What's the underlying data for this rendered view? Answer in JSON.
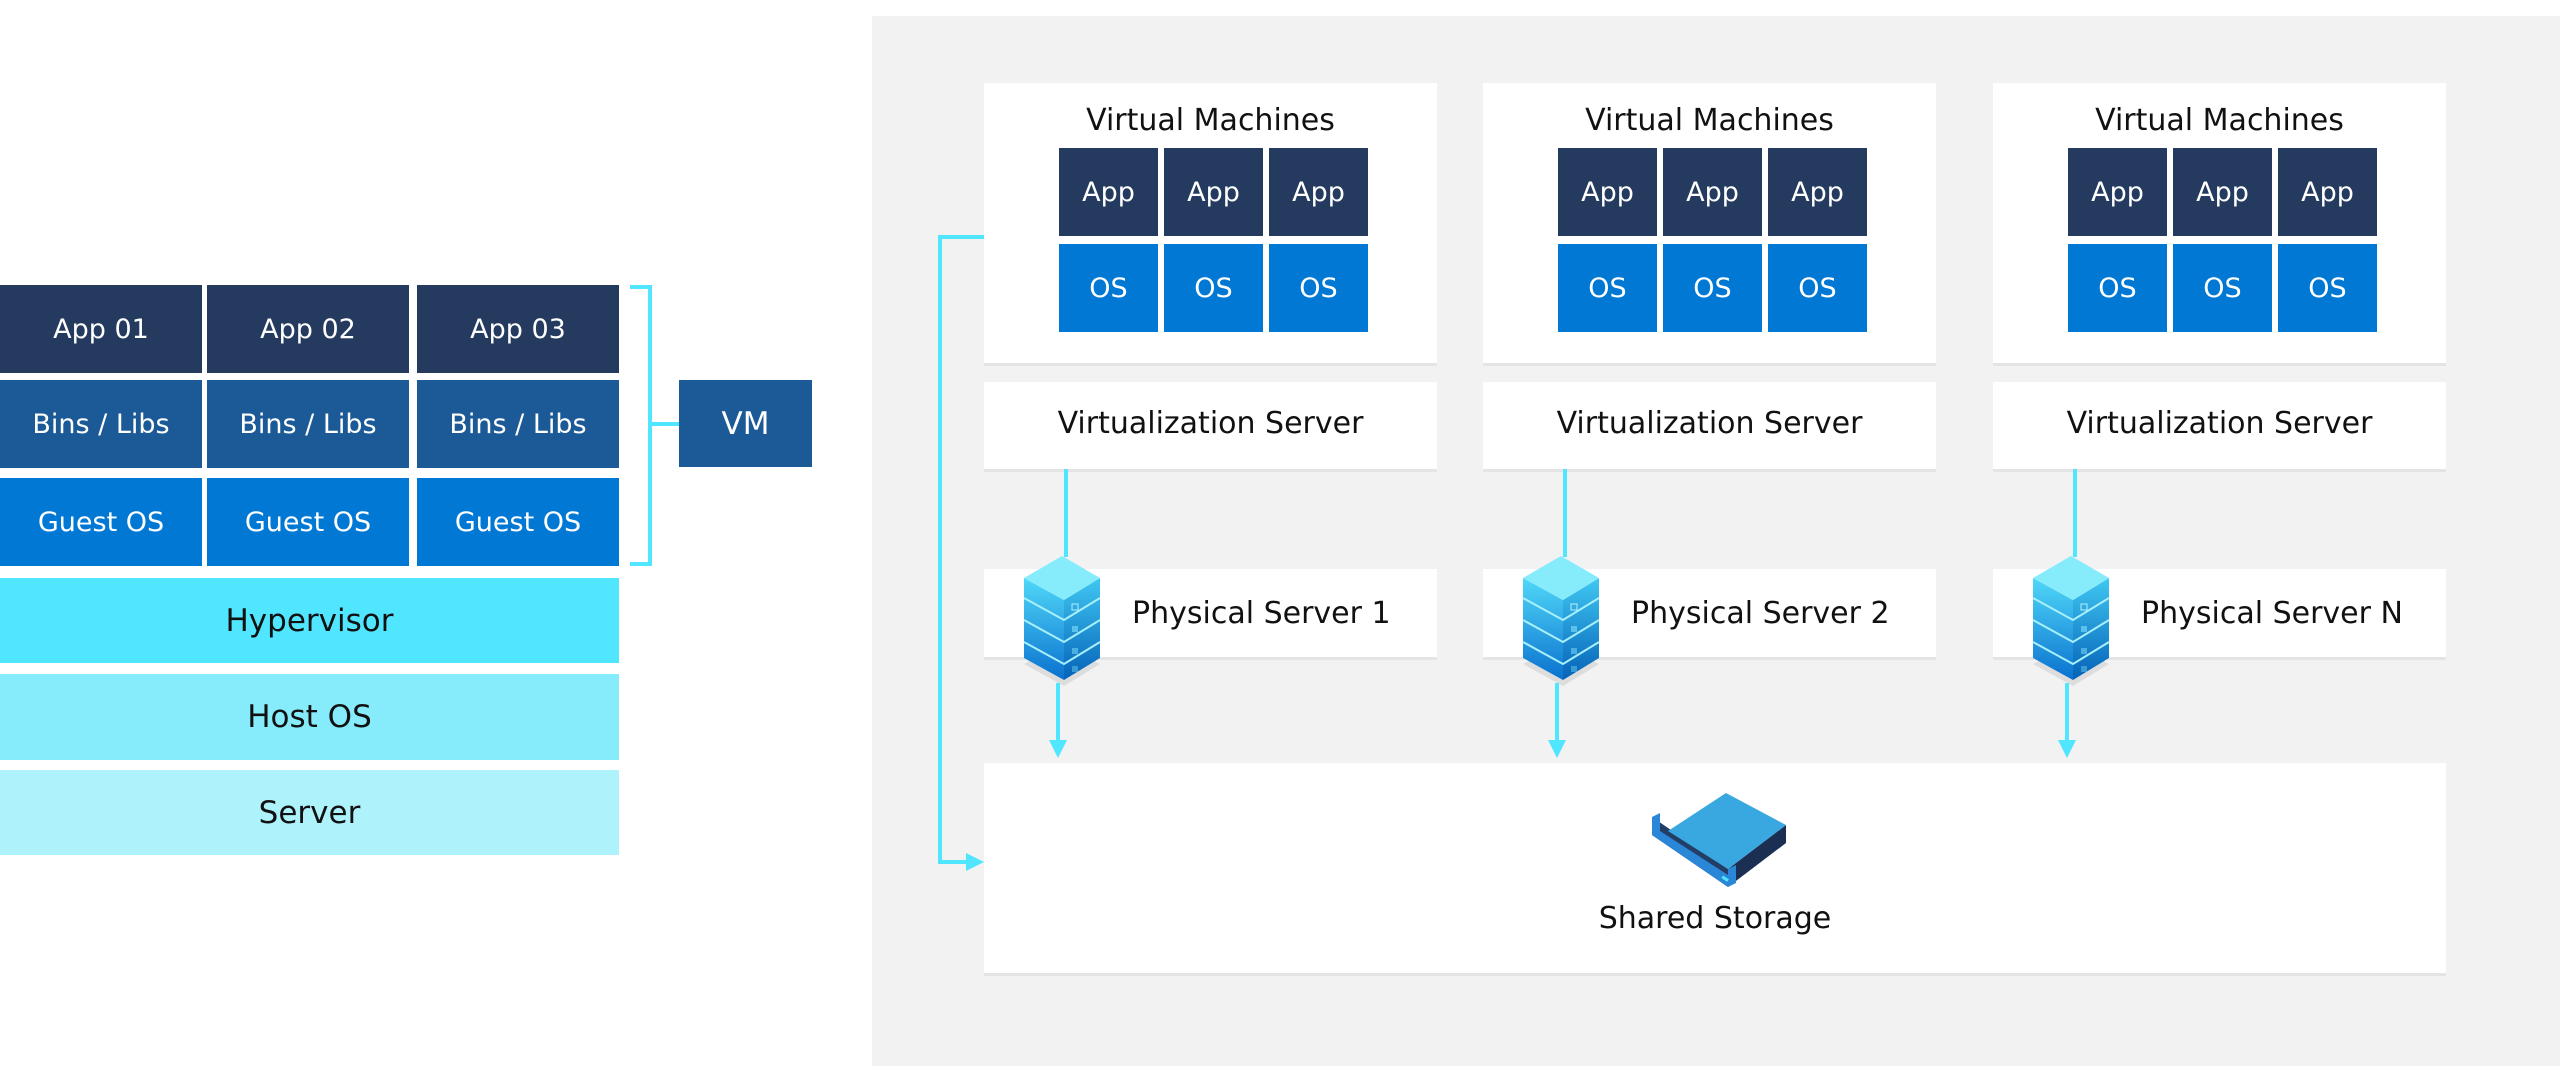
{
  "left_stack": {
    "columns": [
      {
        "app": "App 01",
        "bins": "Bins / Libs",
        "guest_os": "Guest OS"
      },
      {
        "app": "App 02",
        "bins": "Bins / Libs",
        "guest_os": "Guest OS"
      },
      {
        "app": "App 03",
        "bins": "Bins / Libs",
        "guest_os": "Guest OS"
      }
    ],
    "vm_label": "VM",
    "layers": {
      "hypervisor": "Hypervisor",
      "host_os": "Host OS",
      "server": "Server"
    }
  },
  "right_panel": {
    "columns": [
      {
        "vm_title": "Virtual Machines",
        "apps": [
          "App",
          "App",
          "App"
        ],
        "os": [
          "OS",
          "OS",
          "OS"
        ],
        "virtualization_server": "Virtualization Server",
        "physical_server": "Physical Server 1"
      },
      {
        "vm_title": "Virtual Machines",
        "apps": [
          "App",
          "App",
          "App"
        ],
        "os": [
          "OS",
          "OS",
          "OS"
        ],
        "virtualization_server": "Virtualization Server",
        "physical_server": "Physical Server 2"
      },
      {
        "vm_title": "Virtual Machines",
        "apps": [
          "App",
          "App",
          "App"
        ],
        "os": [
          "OS",
          "OS",
          "OS"
        ],
        "virtualization_server": "Virtualization Server",
        "physical_server": "Physical Server N"
      }
    ],
    "shared_storage": "Shared Storage"
  },
  "colors": {
    "app": "#243a5e",
    "bins": "#1b5a96",
    "guest_os": "#0078d4",
    "hypervisor": "#50e6ff",
    "host_os": "#86ecfc",
    "server": "#aef2fb",
    "connector": "#50e6ff",
    "panel_bg": "#f2f2f2"
  },
  "icons": {
    "server": "server-rack-icon",
    "storage": "storage-drive-icon"
  }
}
